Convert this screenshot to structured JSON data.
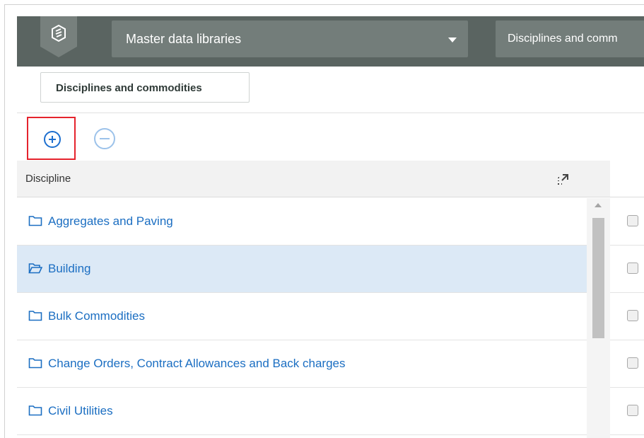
{
  "header": {
    "library_select_label": "Master data libraries",
    "breadcrumb_label": "Disciplines and comm",
    "colors": {
      "bar": "#5a6461",
      "select": "#737d7a"
    }
  },
  "tabs": [
    {
      "label": "Disciplines and commodities"
    }
  ],
  "toolbar": {
    "add_icon": "plus-circle-icon",
    "remove_icon": "minus-circle-icon",
    "highlight_color": "#e5232d"
  },
  "grid": {
    "column_header": "Discipline",
    "expand_icon": "expand-icon",
    "rows": [
      {
        "label": "Aggregates and Paving",
        "icon": "folder-icon",
        "selected": false
      },
      {
        "label": "Building",
        "icon": "folder-open-icon",
        "selected": true
      },
      {
        "label": "Bulk Commodities",
        "icon": "folder-icon",
        "selected": false
      },
      {
        "label": "Change Orders, Contract Allowances and Back charges",
        "icon": "folder-icon",
        "selected": false
      },
      {
        "label": "Civil Utilities",
        "icon": "folder-icon",
        "selected": false
      }
    ],
    "link_color": "#1b6ec2",
    "selected_row_color": "#dce9f6"
  }
}
